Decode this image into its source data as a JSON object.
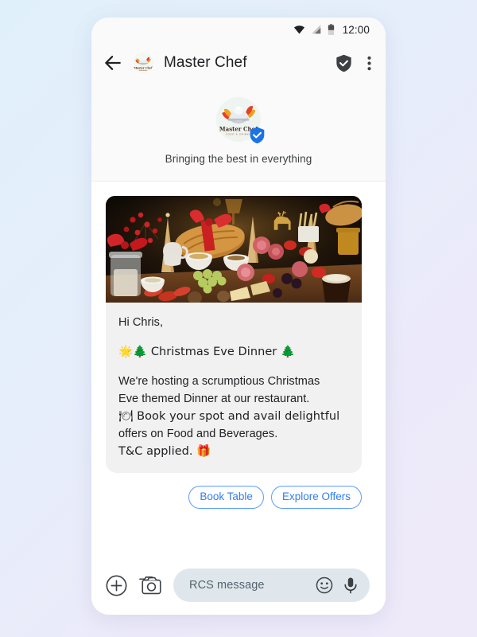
{
  "statusbar": {
    "time": "12:00",
    "icons": [
      "wifi-icon",
      "cellular-signal-icon",
      "battery-icon"
    ]
  },
  "appbar": {
    "back_icon": "back-arrow-icon",
    "avatar_icon": "master-chef-logo-avatar",
    "title": "Master Chef",
    "verified_icon": "verified-shield-icon",
    "overflow_icon": "more-vertical-icon"
  },
  "profile": {
    "logo_name": "Master Chef",
    "logo_sub": "FOOD & DRINKS",
    "verified_icon": "verified-badge-icon",
    "tagline": "Bringing the best in everything"
  },
  "message": {
    "hero_alt": "christmas-dinner-spread-photo",
    "greeting": "Hi Chris,",
    "headline": "🌟🌲 Christmas Eve Dinner 🌲",
    "body_line1": "We're hosting a scrumptious Christmas",
    "body_line2": "Eve themed Dinner at our restaurant.",
    "body_line3": "🍽 Book your spot and avail delightful",
    "body_line4": "offers on Food and Beverages.",
    "body_line5": "T&C applied. 🎁"
  },
  "actions": {
    "book_table": "Book Table",
    "explore_offers": "Explore Offers"
  },
  "composer": {
    "add_icon": "plus-circle-icon",
    "camera_icon": "camera-icon",
    "placeholder": "RCS message",
    "emoji_icon": "emoji-smiley-icon",
    "mic_icon": "microphone-icon"
  },
  "colors": {
    "accent_blue": "#2f7df4",
    "verified_blue": "#1a73e8",
    "bubble_bg": "#f1f1f1",
    "input_bg": "#dfe7ec",
    "page_gradient_start": "#e0f0fb",
    "page_gradient_end": "#efeafa"
  }
}
